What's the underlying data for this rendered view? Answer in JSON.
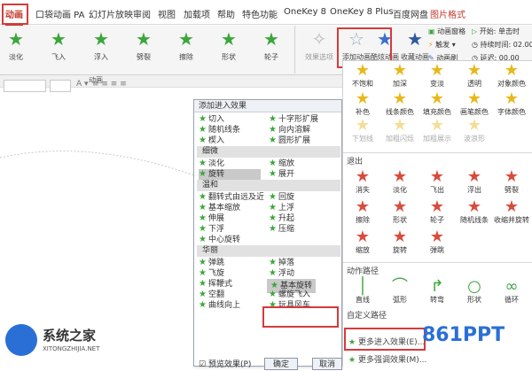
{
  "tabs": [
    {
      "label": "动画",
      "active": true
    },
    {
      "label": "口袋动画 PA"
    },
    {
      "label": "幻灯片放映"
    },
    {
      "label": "审阅"
    },
    {
      "label": "视图"
    },
    {
      "label": "加载项"
    },
    {
      "label": "帮助"
    },
    {
      "label": "特色功能"
    },
    {
      "label": "OneKey 8"
    },
    {
      "label": "OneKey 8 Plus"
    },
    {
      "label": "百度网盘"
    },
    {
      "label": "图片格式"
    }
  ],
  "ribbon": {
    "effects": [
      "淡化",
      "飞入",
      "浮入",
      "劈裂",
      "擦除",
      "形状",
      "轮子"
    ],
    "effect_options": "效果选项",
    "add_animation": "添加动画",
    "painter": "酷炫动画",
    "favorites": "收藏动画",
    "pane": "动画窗格",
    "trigger": "触发",
    "brush": "动画刷",
    "start_label": "开始:",
    "start_value": "单击时",
    "duration_label": "持续时间:",
    "duration_value": "02.00",
    "delay_label": "延迟:",
    "delay_value": "00.00",
    "group_label": "动画"
  },
  "dialog": {
    "title": "添加进入效果",
    "top_rows": [
      [
        "切入",
        "十字形扩展"
      ],
      [
        "随机线条",
        "向内溶解"
      ],
      [
        "楔入",
        "圆形扩展"
      ]
    ],
    "sections": [
      {
        "name": "细微",
        "rows": [
          [
            "淡化",
            "缩放"
          ],
          [
            "旋转",
            "展开"
          ]
        ]
      },
      {
        "name": "温和",
        "rows": [
          [
            "翻转式由远及近",
            "回旋"
          ],
          [
            "基本缩放",
            "上浮"
          ],
          [
            "伸展",
            "升起"
          ],
          [
            "下浮",
            "压缩"
          ],
          [
            "中心旋转",
            ""
          ]
        ]
      },
      {
        "name": "华丽",
        "rows": [
          [
            "弹跳",
            "掉落"
          ],
          [
            "飞旋",
            "浮动"
          ],
          [
            "挥鞭式",
            "基本旋转"
          ],
          [
            "空翻",
            "螺旋飞入"
          ],
          [
            "曲线向上",
            "玩具风车"
          ]
        ]
      }
    ],
    "hover_item": "基本旋转",
    "preview_label": "预览效果(P)",
    "ok": "确定",
    "cancel": "取消"
  },
  "panel": {
    "emph_row1": [
      "不饱和",
      "加深",
      "变淡",
      "透明",
      "对象颜色"
    ],
    "emph_row2": [
      "补色",
      "线条颜色",
      "填充颜色",
      "画笔颜色",
      "字体颜色"
    ],
    "emph_row3": [
      "下划线",
      "加粗闪烁",
      "加粗展示",
      "波浪形"
    ],
    "exit_header": "退出",
    "exit_row1": [
      "消失",
      "淡化",
      "飞出",
      "浮出",
      "劈裂"
    ],
    "exit_row2": [
      "擦除",
      "形状",
      "轮子",
      "随机线条",
      "收缩并旋转"
    ],
    "exit_row3": [
      "缩放",
      "旋转",
      "弹跳"
    ],
    "path_header": "动作路径",
    "path_row": [
      "直线",
      "弧形",
      "转弯",
      "形状",
      "循环"
    ],
    "custom_path": "自定义路径",
    "more_entrance": "更多进入效果(E)...",
    "more_emphasis": "更多强调效果(M)..."
  },
  "watermarks": {
    "left": "系统之家",
    "left_sub": "XITONGZHIJIA.NET",
    "right": "861PPT"
  },
  "colors": {
    "accent": "#c0392b",
    "highlight": "#d63b3b",
    "green": "#3aa63a"
  }
}
